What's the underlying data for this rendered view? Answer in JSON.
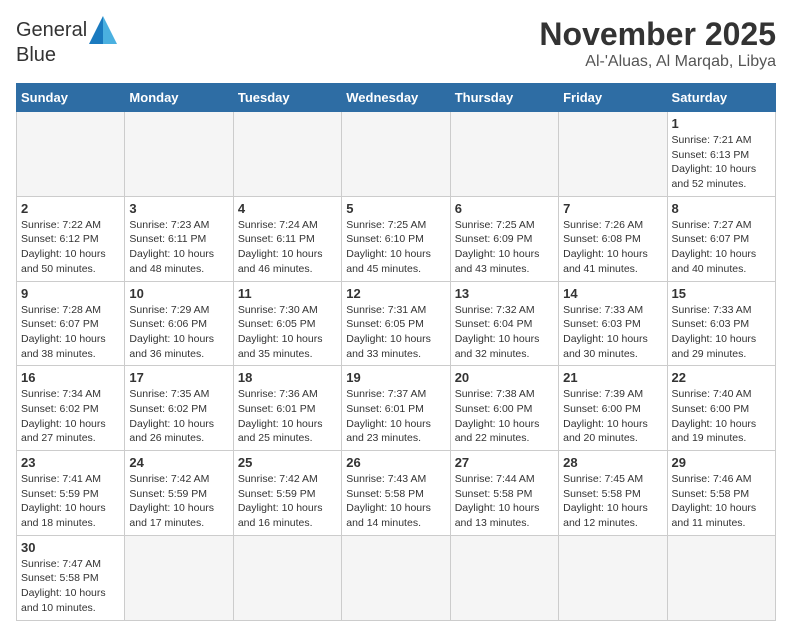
{
  "logo": {
    "line1": "General",
    "line2": "Blue"
  },
  "title": "November 2025",
  "subtitle": "Al-'Aluas, Al Marqab, Libya",
  "weekdays": [
    "Sunday",
    "Monday",
    "Tuesday",
    "Wednesday",
    "Thursday",
    "Friday",
    "Saturday"
  ],
  "weeks": [
    [
      {
        "day": "",
        "info": ""
      },
      {
        "day": "",
        "info": ""
      },
      {
        "day": "",
        "info": ""
      },
      {
        "day": "",
        "info": ""
      },
      {
        "day": "",
        "info": ""
      },
      {
        "day": "",
        "info": ""
      },
      {
        "day": "1",
        "info": "Sunrise: 7:21 AM\nSunset: 6:13 PM\nDaylight: 10 hours and 52 minutes."
      }
    ],
    [
      {
        "day": "2",
        "info": "Sunrise: 7:22 AM\nSunset: 6:12 PM\nDaylight: 10 hours and 50 minutes."
      },
      {
        "day": "3",
        "info": "Sunrise: 7:23 AM\nSunset: 6:11 PM\nDaylight: 10 hours and 48 minutes."
      },
      {
        "day": "4",
        "info": "Sunrise: 7:24 AM\nSunset: 6:11 PM\nDaylight: 10 hours and 46 minutes."
      },
      {
        "day": "5",
        "info": "Sunrise: 7:25 AM\nSunset: 6:10 PM\nDaylight: 10 hours and 45 minutes."
      },
      {
        "day": "6",
        "info": "Sunrise: 7:25 AM\nSunset: 6:09 PM\nDaylight: 10 hours and 43 minutes."
      },
      {
        "day": "7",
        "info": "Sunrise: 7:26 AM\nSunset: 6:08 PM\nDaylight: 10 hours and 41 minutes."
      },
      {
        "day": "8",
        "info": "Sunrise: 7:27 AM\nSunset: 6:07 PM\nDaylight: 10 hours and 40 minutes."
      }
    ],
    [
      {
        "day": "9",
        "info": "Sunrise: 7:28 AM\nSunset: 6:07 PM\nDaylight: 10 hours and 38 minutes."
      },
      {
        "day": "10",
        "info": "Sunrise: 7:29 AM\nSunset: 6:06 PM\nDaylight: 10 hours and 36 minutes."
      },
      {
        "day": "11",
        "info": "Sunrise: 7:30 AM\nSunset: 6:05 PM\nDaylight: 10 hours and 35 minutes."
      },
      {
        "day": "12",
        "info": "Sunrise: 7:31 AM\nSunset: 6:05 PM\nDaylight: 10 hours and 33 minutes."
      },
      {
        "day": "13",
        "info": "Sunrise: 7:32 AM\nSunset: 6:04 PM\nDaylight: 10 hours and 32 minutes."
      },
      {
        "day": "14",
        "info": "Sunrise: 7:33 AM\nSunset: 6:03 PM\nDaylight: 10 hours and 30 minutes."
      },
      {
        "day": "15",
        "info": "Sunrise: 7:33 AM\nSunset: 6:03 PM\nDaylight: 10 hours and 29 minutes."
      }
    ],
    [
      {
        "day": "16",
        "info": "Sunrise: 7:34 AM\nSunset: 6:02 PM\nDaylight: 10 hours and 27 minutes."
      },
      {
        "day": "17",
        "info": "Sunrise: 7:35 AM\nSunset: 6:02 PM\nDaylight: 10 hours and 26 minutes."
      },
      {
        "day": "18",
        "info": "Sunrise: 7:36 AM\nSunset: 6:01 PM\nDaylight: 10 hours and 25 minutes."
      },
      {
        "day": "19",
        "info": "Sunrise: 7:37 AM\nSunset: 6:01 PM\nDaylight: 10 hours and 23 minutes."
      },
      {
        "day": "20",
        "info": "Sunrise: 7:38 AM\nSunset: 6:00 PM\nDaylight: 10 hours and 22 minutes."
      },
      {
        "day": "21",
        "info": "Sunrise: 7:39 AM\nSunset: 6:00 PM\nDaylight: 10 hours and 20 minutes."
      },
      {
        "day": "22",
        "info": "Sunrise: 7:40 AM\nSunset: 6:00 PM\nDaylight: 10 hours and 19 minutes."
      }
    ],
    [
      {
        "day": "23",
        "info": "Sunrise: 7:41 AM\nSunset: 5:59 PM\nDaylight: 10 hours and 18 minutes."
      },
      {
        "day": "24",
        "info": "Sunrise: 7:42 AM\nSunset: 5:59 PM\nDaylight: 10 hours and 17 minutes."
      },
      {
        "day": "25",
        "info": "Sunrise: 7:42 AM\nSunset: 5:59 PM\nDaylight: 10 hours and 16 minutes."
      },
      {
        "day": "26",
        "info": "Sunrise: 7:43 AM\nSunset: 5:58 PM\nDaylight: 10 hours and 14 minutes."
      },
      {
        "day": "27",
        "info": "Sunrise: 7:44 AM\nSunset: 5:58 PM\nDaylight: 10 hours and 13 minutes."
      },
      {
        "day": "28",
        "info": "Sunrise: 7:45 AM\nSunset: 5:58 PM\nDaylight: 10 hours and 12 minutes."
      },
      {
        "day": "29",
        "info": "Sunrise: 7:46 AM\nSunset: 5:58 PM\nDaylight: 10 hours and 11 minutes."
      }
    ],
    [
      {
        "day": "30",
        "info": "Sunrise: 7:47 AM\nSunset: 5:58 PM\nDaylight: 10 hours and 10 minutes."
      },
      {
        "day": "",
        "info": ""
      },
      {
        "day": "",
        "info": ""
      },
      {
        "day": "",
        "info": ""
      },
      {
        "day": "",
        "info": ""
      },
      {
        "day": "",
        "info": ""
      },
      {
        "day": "",
        "info": ""
      }
    ]
  ]
}
